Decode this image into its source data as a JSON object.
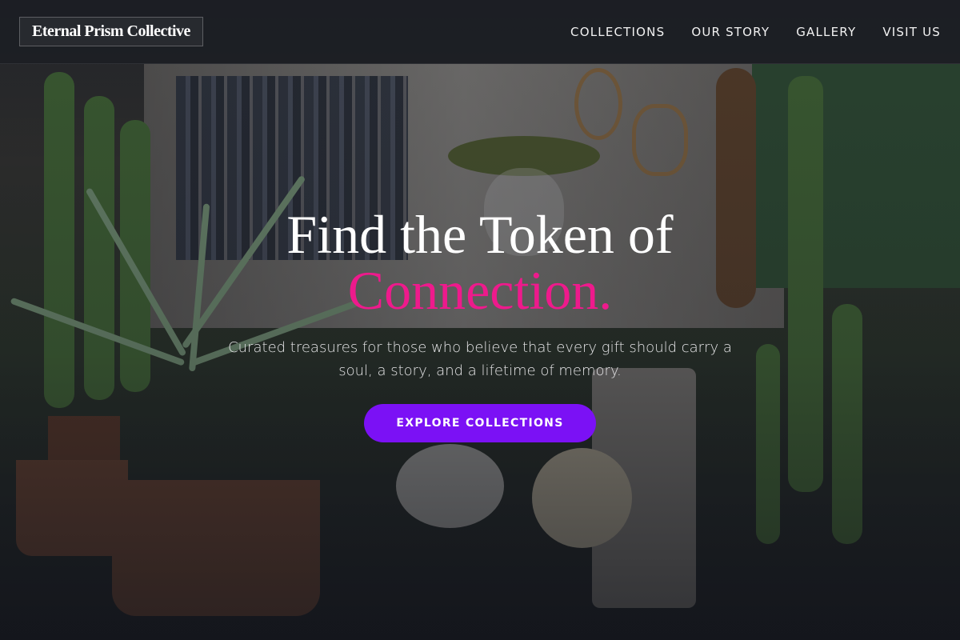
{
  "brand": {
    "name": "Eternal Prism Collective"
  },
  "nav": {
    "links": [
      {
        "label": "COLLECTIONS"
      },
      {
        "label": "OUR STORY"
      },
      {
        "label": "GALLERY"
      },
      {
        "label": "VISIT US"
      }
    ]
  },
  "hero": {
    "headline_line1": "Find the Token of",
    "headline_line2": "Connection.",
    "subtitle": "Curated treasures for those who believe that every gift should carry a soul, a story, and a lifetime of memory.",
    "cta_label": "EXPLORE COLLECTIONS"
  },
  "colors": {
    "accent": "#ee1a8c",
    "cta_background": "#7b11f5",
    "nav_background": "#1c1e24"
  }
}
